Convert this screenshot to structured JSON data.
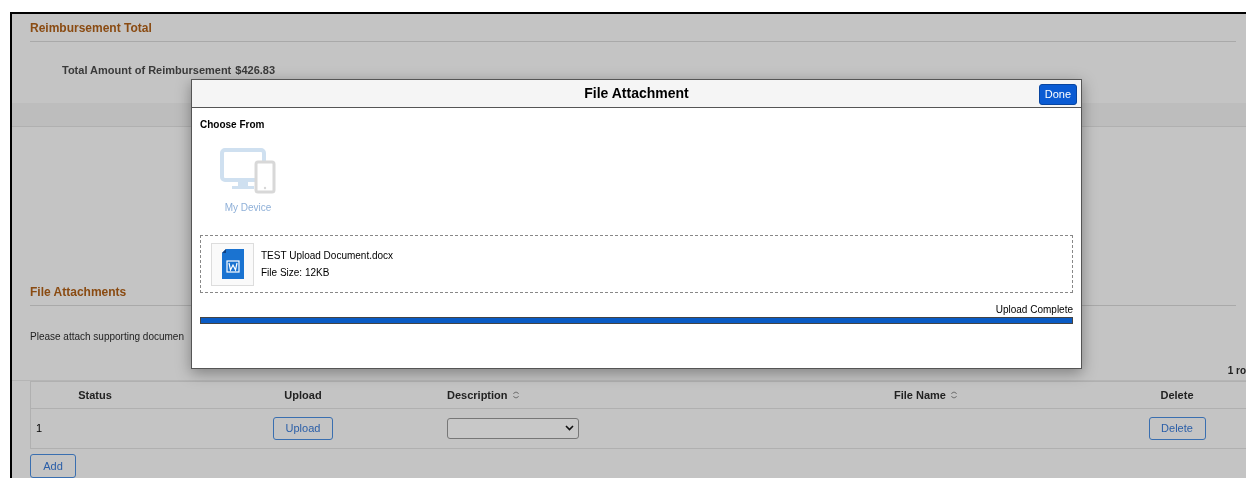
{
  "reimbursement_total": {
    "heading": "Reimbursement Total",
    "label": "Total Amount of Reimbursement",
    "value": "$426.83"
  },
  "file_attachments": {
    "heading": "File Attachments",
    "instructions": "Please attach supporting documen",
    "row_count": "1 ro",
    "columns": [
      {
        "label": "Status",
        "sortable": false
      },
      {
        "label": "Upload",
        "sortable": false
      },
      {
        "label": "Description",
        "sortable": true
      },
      {
        "label": "File Name",
        "sortable": true
      },
      {
        "label": "Delete",
        "sortable": false
      }
    ],
    "rows": [
      {
        "status": "1",
        "upload_button": "Upload",
        "delete_button": "Delete"
      }
    ],
    "add_button": "Add"
  },
  "dialog": {
    "title": "File Attachment",
    "done_button": "Done",
    "choose_from": "Choose From",
    "source": "My Device",
    "file": {
      "name": "TEST Upload Document.docx",
      "size": "File Size: 12KB"
    },
    "progress": {
      "status": "Upload Complete",
      "level": 1
    }
  }
}
